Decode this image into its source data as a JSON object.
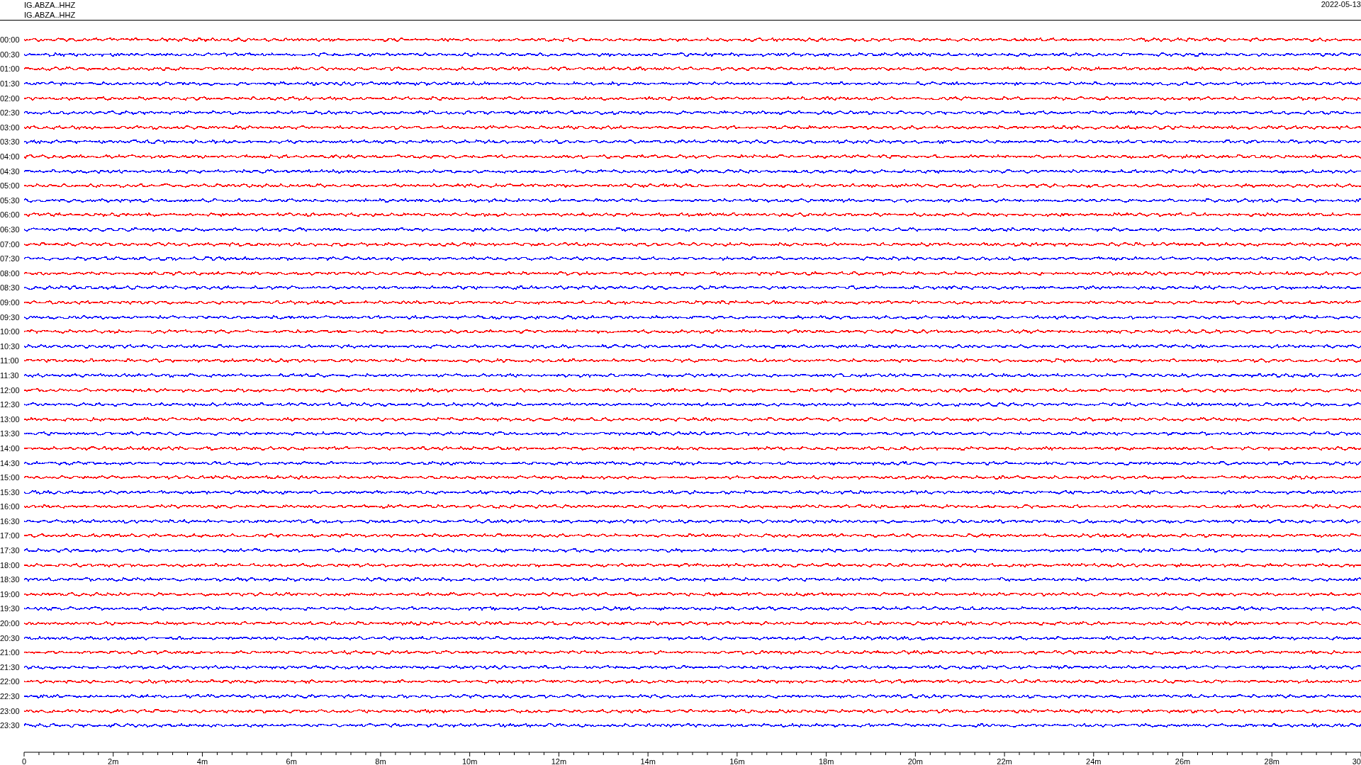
{
  "header": {
    "channel_labels": [
      "IG.ABZA..HHZ",
      "IG.ABZA..HHZ"
    ],
    "date": "2022-05-13"
  },
  "rows": [
    {
      "time": "00:00",
      "color": "#ff0000"
    },
    {
      "time": "00:30",
      "color": "#0000ff"
    },
    {
      "time": "01:00",
      "color": "#ff0000"
    },
    {
      "time": "01:30",
      "color": "#0000ff"
    },
    {
      "time": "02:00",
      "color": "#ff0000"
    },
    {
      "time": "02:30",
      "color": "#0000ff"
    },
    {
      "time": "03:00",
      "color": "#ff0000"
    },
    {
      "time": "03:30",
      "color": "#0000ff"
    },
    {
      "time": "04:00",
      "color": "#ff0000"
    },
    {
      "time": "04:30",
      "color": "#0000ff"
    },
    {
      "time": "05:00",
      "color": "#ff0000"
    },
    {
      "time": "05:30",
      "color": "#0000ff"
    },
    {
      "time": "06:00",
      "color": "#ff0000"
    },
    {
      "time": "06:30",
      "color": "#0000ff"
    },
    {
      "time": "07:00",
      "color": "#ff0000"
    },
    {
      "time": "07:30",
      "color": "#0000ff"
    },
    {
      "time": "08:00",
      "color": "#ff0000"
    },
    {
      "time": "08:30",
      "color": "#0000ff"
    },
    {
      "time": "09:00",
      "color": "#ff0000"
    },
    {
      "time": "09:30",
      "color": "#0000ff"
    },
    {
      "time": "10:00",
      "color": "#ff0000"
    },
    {
      "time": "10:30",
      "color": "#0000ff"
    },
    {
      "time": "11:00",
      "color": "#ff0000"
    },
    {
      "time": "11:30",
      "color": "#0000ff"
    },
    {
      "time": "12:00",
      "color": "#ff0000"
    },
    {
      "time": "12:30",
      "color": "#0000ff"
    },
    {
      "time": "13:00",
      "color": "#ff0000"
    },
    {
      "time": "13:30",
      "color": "#0000ff"
    },
    {
      "time": "14:00",
      "color": "#ff0000"
    },
    {
      "time": "14:30",
      "color": "#0000ff"
    },
    {
      "time": "15:00",
      "color": "#ff0000"
    },
    {
      "time": "15:30",
      "color": "#0000ff"
    },
    {
      "time": "16:00",
      "color": "#ff0000"
    },
    {
      "time": "16:30",
      "color": "#0000ff"
    },
    {
      "time": "17:00",
      "color": "#ff0000"
    },
    {
      "time": "17:30",
      "color": "#0000ff"
    },
    {
      "time": "18:00",
      "color": "#ff0000"
    },
    {
      "time": "18:30",
      "color": "#0000ff"
    },
    {
      "time": "19:00",
      "color": "#ff0000"
    },
    {
      "time": "19:30",
      "color": "#0000ff"
    },
    {
      "time": "20:00",
      "color": "#ff0000"
    },
    {
      "time": "20:30",
      "color": "#0000ff"
    },
    {
      "time": "21:00",
      "color": "#ff0000"
    },
    {
      "time": "21:30",
      "color": "#0000ff"
    },
    {
      "time": "22:00",
      "color": "#ff0000"
    },
    {
      "time": "22:30",
      "color": "#0000ff"
    },
    {
      "time": "23:00",
      "color": "#ff0000"
    },
    {
      "time": "23:30",
      "color": "#0000ff"
    }
  ],
  "x_axis": {
    "ticks": [
      "0",
      "2m",
      "4m",
      "6m",
      "8m",
      "10m",
      "12m",
      "14m",
      "16m",
      "18m",
      "20m",
      "22m",
      "24m",
      "26m",
      "28m",
      "30"
    ]
  }
}
